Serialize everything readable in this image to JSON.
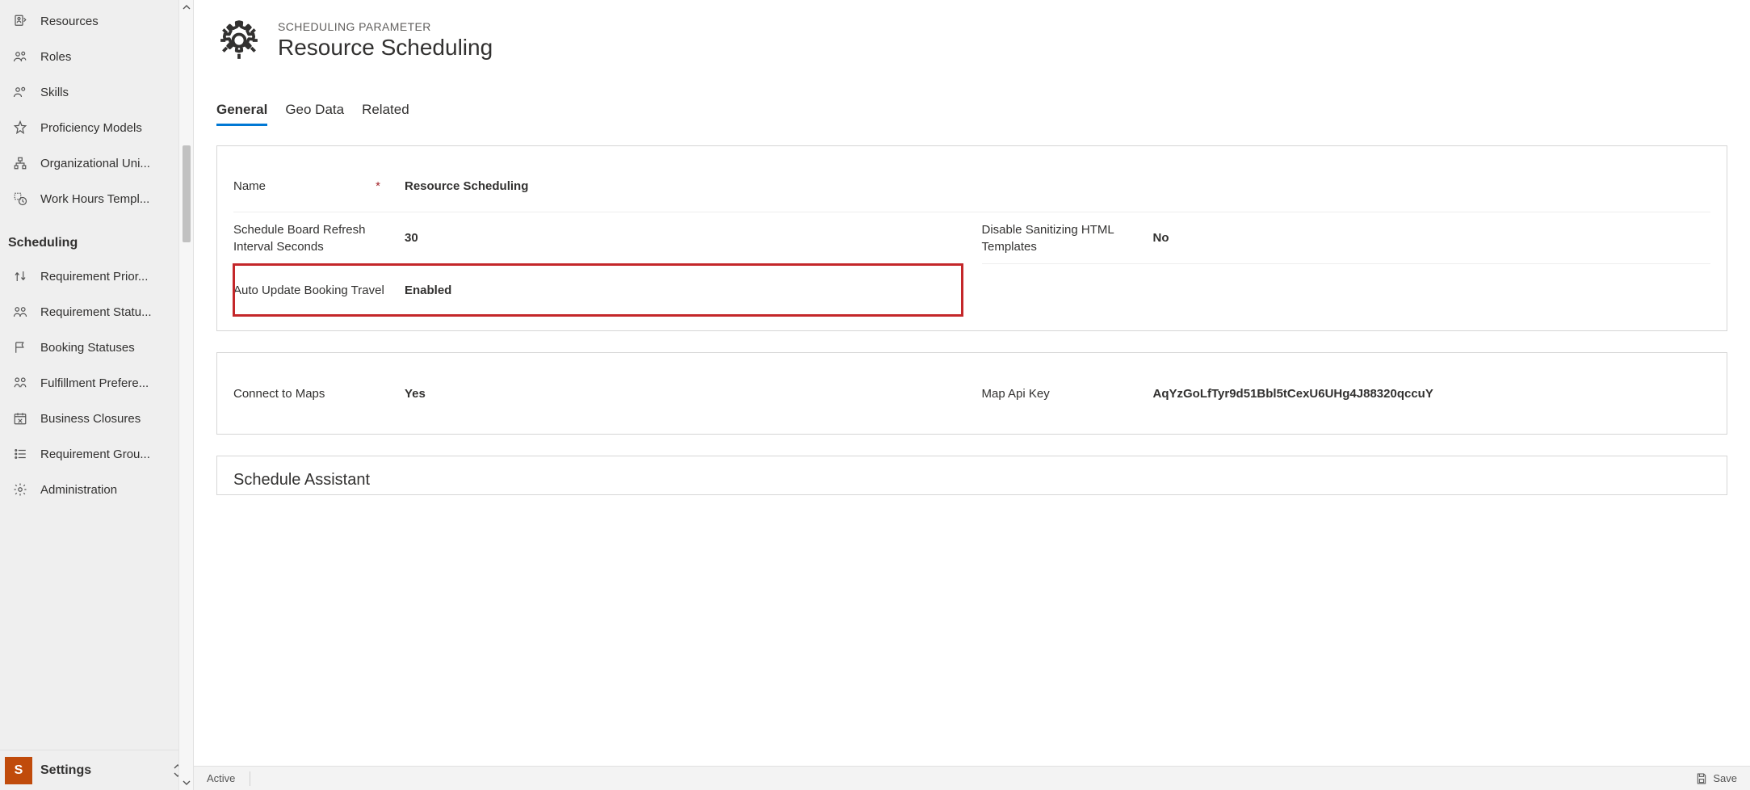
{
  "sidebar": {
    "items": [
      {
        "label": "Resources"
      },
      {
        "label": "Roles"
      },
      {
        "label": "Skills"
      },
      {
        "label": "Proficiency Models"
      },
      {
        "label": "Organizational Uni..."
      },
      {
        "label": "Work Hours Templ..."
      }
    ],
    "group_header": "Scheduling",
    "schedItems": [
      {
        "label": "Requirement Prior..."
      },
      {
        "label": "Requirement Statu..."
      },
      {
        "label": "Booking Statuses"
      },
      {
        "label": "Fulfillment Prefere..."
      },
      {
        "label": "Business Closures"
      },
      {
        "label": "Requirement Grou..."
      },
      {
        "label": "Administration"
      }
    ],
    "footer": {
      "tile_letter": "S",
      "label": "Settings"
    }
  },
  "header": {
    "eyebrow": "SCHEDULING PARAMETER",
    "title": "Resource Scheduling"
  },
  "tabs": [
    {
      "label": "General",
      "active": true
    },
    {
      "label": "Geo Data",
      "active": false
    },
    {
      "label": "Related",
      "active": false
    }
  ],
  "form": {
    "name": {
      "label": "Name",
      "value": "Resource Scheduling",
      "required": true
    },
    "refresh": {
      "label": "Schedule Board Refresh Interval Seconds",
      "value": "30"
    },
    "sanitize": {
      "label": "Disable Sanitizing HTML Templates",
      "value": "No"
    },
    "autoTravel": {
      "label": "Auto Update Booking Travel",
      "value": "Enabled"
    },
    "connectMaps": {
      "label": "Connect to Maps",
      "value": "Yes"
    },
    "mapApiKey": {
      "label": "Map Api Key",
      "value": "AqYzGoLfTyr9d51Bbl5tCexU6UHg4J88320qccuY"
    },
    "scheduleAssistantTitle": "Schedule Assistant"
  },
  "statusbar": {
    "status": "Active",
    "save": "Save"
  },
  "required_star": "*"
}
